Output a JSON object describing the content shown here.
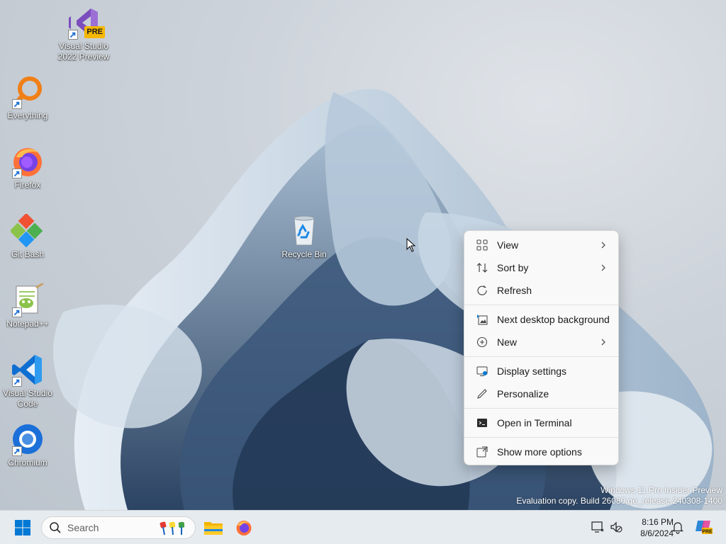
{
  "desktop": {
    "icons": [
      {
        "label": "Visual Studio 2022 Preview",
        "badge": "PRE",
        "icon": "visual-studio-icon"
      },
      {
        "label": "Everything",
        "icon": "everything-search-icon"
      },
      {
        "label": "Firefox",
        "icon": "firefox-icon"
      },
      {
        "label": "Git Bash",
        "icon": "git-bash-icon"
      },
      {
        "label": "Notepad++",
        "icon": "notepad-plus-plus-icon"
      },
      {
        "label": "Visual Studio Code",
        "icon": "vscode-icon"
      },
      {
        "label": "Chromium",
        "icon": "chromium-icon"
      },
      {
        "label": "Recycle Bin",
        "icon": "recycle-bin-icon"
      }
    ]
  },
  "context_menu": {
    "items": [
      {
        "label": "View",
        "icon": "view-grid-icon",
        "submenu": true
      },
      {
        "label": "Sort by",
        "icon": "sort-icon",
        "submenu": true
      },
      {
        "label": "Refresh",
        "icon": "refresh-icon",
        "submenu": false
      },
      {
        "label": "Next desktop background",
        "icon": "next-background-icon",
        "submenu": false
      },
      {
        "label": "New",
        "icon": "new-plus-icon",
        "submenu": true
      },
      {
        "label": "Display settings",
        "icon": "display-settings-icon",
        "submenu": false
      },
      {
        "label": "Personalize",
        "icon": "pen-icon",
        "submenu": false
      },
      {
        "label": "Open in Terminal",
        "icon": "terminal-icon",
        "submenu": false
      },
      {
        "label": "Show more options",
        "icon": "more-options-icon",
        "submenu": false
      }
    ]
  },
  "watermark": {
    "line1": "Windows 11 Pro Insider Preview",
    "line2": "Evaluation copy. Build 26080.ge_release.240308-1400"
  },
  "taskbar": {
    "search_placeholder": "Search",
    "time": "8:16 PM",
    "date": "8/6/2024",
    "accent": "#0078d4"
  }
}
